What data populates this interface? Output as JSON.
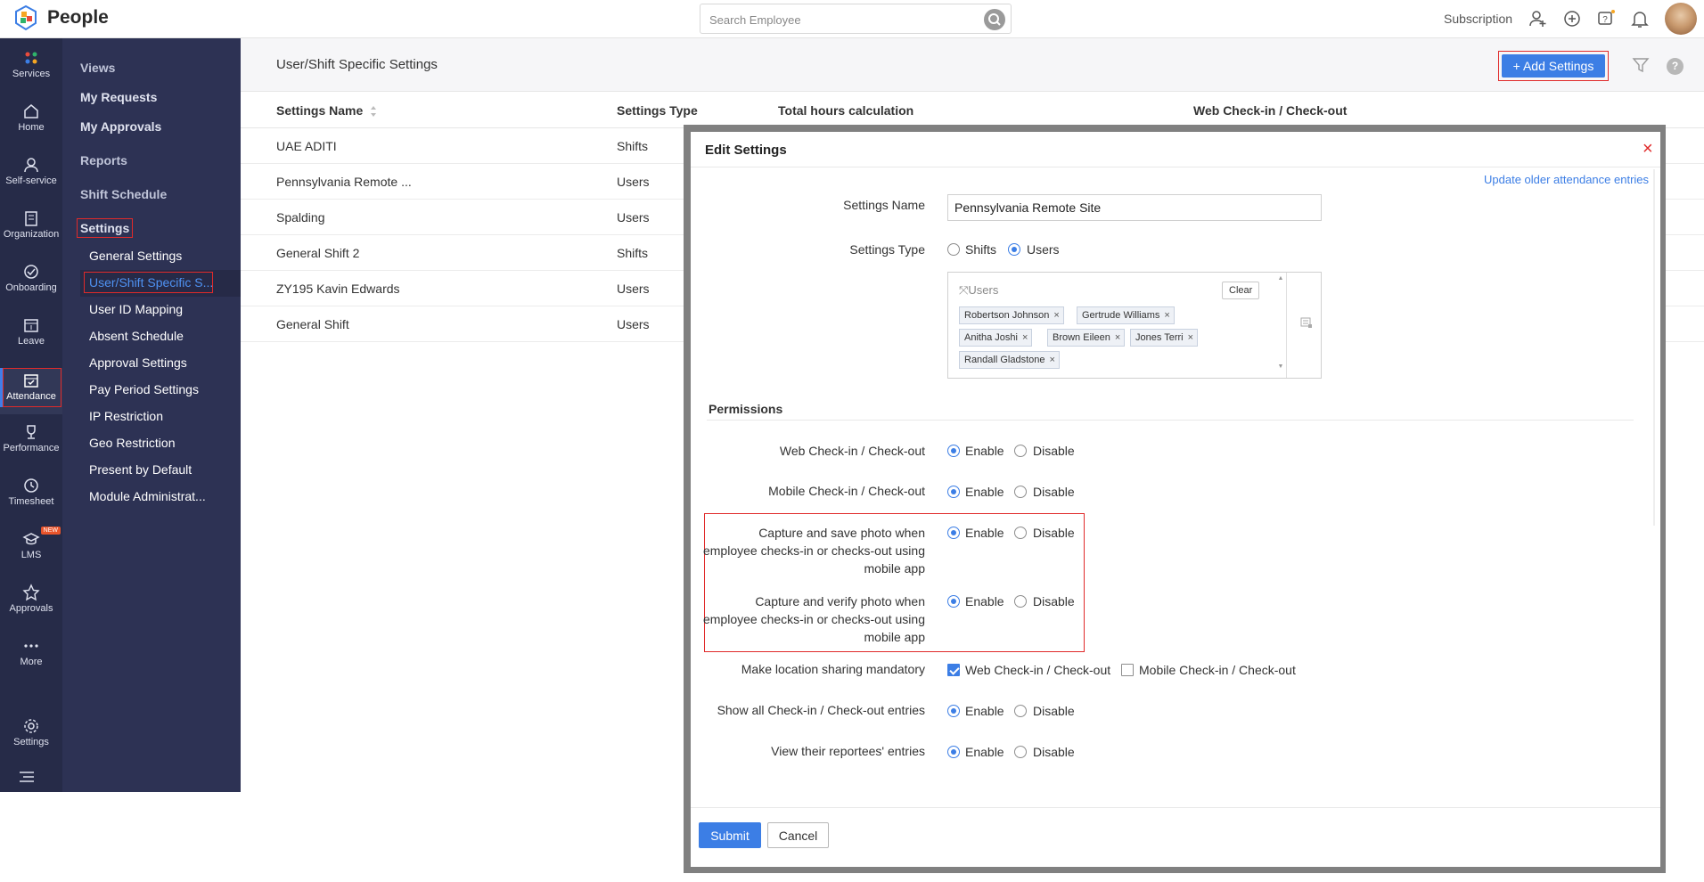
{
  "app": {
    "title": "People"
  },
  "search": {
    "placeholder": "Search Employee"
  },
  "header": {
    "subscription": "Subscription"
  },
  "leftnav": {
    "items": [
      {
        "label": "Services",
        "icon": "services-icon"
      },
      {
        "label": "Home",
        "icon": "home-icon"
      },
      {
        "label": "Self-service",
        "icon": "person-icon"
      },
      {
        "label": "Organization",
        "icon": "building-icon"
      },
      {
        "label": "Onboarding",
        "icon": "onboarding-icon"
      },
      {
        "label": "Leave",
        "icon": "calendar-icon"
      },
      {
        "label": "Attendance",
        "icon": "attendance-icon"
      },
      {
        "label": "Performance",
        "icon": "trophy-icon"
      },
      {
        "label": "Timesheet",
        "icon": "clock-icon"
      },
      {
        "label": "LMS",
        "icon": "graduation-cap-icon",
        "badge": "NEW"
      },
      {
        "label": "Approvals",
        "icon": "star-icon"
      },
      {
        "label": "More",
        "icon": "more-icon"
      },
      {
        "label": "Settings",
        "icon": "gear-icon"
      }
    ]
  },
  "subnav": {
    "views": "Views",
    "my_requests": "My Requests",
    "my_approvals": "My Approvals",
    "reports": "Reports",
    "shift_schedule": "Shift Schedule",
    "settings": "Settings",
    "items": [
      "General Settings",
      "User/Shift Specific S...",
      "User ID Mapping",
      "Absent Schedule",
      "Approval Settings",
      "Pay Period Settings",
      "IP Restriction",
      "Geo Restriction",
      "Present by Default",
      "Module Administrat..."
    ]
  },
  "page": {
    "title": "User/Shift Specific Settings",
    "add_button": "Add Settings",
    "help": "?"
  },
  "table": {
    "headers": [
      "Settings Name",
      "Settings Type",
      "Total hours calculation",
      "Web Check-in / Check-out"
    ],
    "rows": [
      [
        "UAE ADITI",
        "Shifts"
      ],
      [
        "Pennsylvania Remote ...",
        "Users"
      ],
      [
        "Spalding",
        "Users"
      ],
      [
        "General Shift 2",
        "Shifts"
      ],
      [
        "ZY195 Kavin Edwards",
        "Users"
      ],
      [
        "General Shift",
        "Users"
      ]
    ]
  },
  "modal": {
    "title": "Edit Settings",
    "close": "×",
    "update_link": "Update older attendance entries",
    "settings_name_label": "Settings Name",
    "settings_name_value": "Pennsylvania Remote Site",
    "settings_type_label": "Settings Type",
    "type_options": [
      "Shifts",
      "Users"
    ],
    "type_selected": "Users",
    "users_box_title": "Users",
    "clear": "Clear",
    "users": [
      "Robertson Johnson",
      "Gertrude Williams",
      "Anitha Joshi",
      "Brown Eileen",
      "Jones Terri",
      "Randall Gladstone"
    ],
    "permissions_title": "Permissions",
    "enable": "Enable",
    "disable": "Disable",
    "permissions": [
      {
        "label": "Web Check-in / Check-out",
        "value": "Enable"
      },
      {
        "label": "Mobile Check-in / Check-out",
        "value": "Enable"
      },
      {
        "label_lines": [
          "Capture and save photo when",
          "employee checks-in or checks-out using",
          "mobile app"
        ],
        "value": "Enable"
      },
      {
        "label_lines": [
          "Capture and verify photo when",
          "employee checks-in or checks-out using",
          "mobile app"
        ],
        "value": "Enable"
      },
      {
        "label": "Make location sharing mandatory",
        "options": [
          {
            "label": "Web Check-in / Check-out",
            "checked": true
          },
          {
            "label": "Mobile Check-in / Check-out",
            "checked": false
          }
        ]
      },
      {
        "label": "Show all Check-in / Check-out entries",
        "value": "Enable"
      },
      {
        "label": "View their reportees' entries",
        "value": "Enable"
      }
    ],
    "submit": "Submit",
    "cancel": "Cancel"
  },
  "colors": {
    "primary": "#3c7ee5",
    "sidebar": "#262b48",
    "subnav": "#2d3254",
    "highlight": "#e02a2a"
  }
}
